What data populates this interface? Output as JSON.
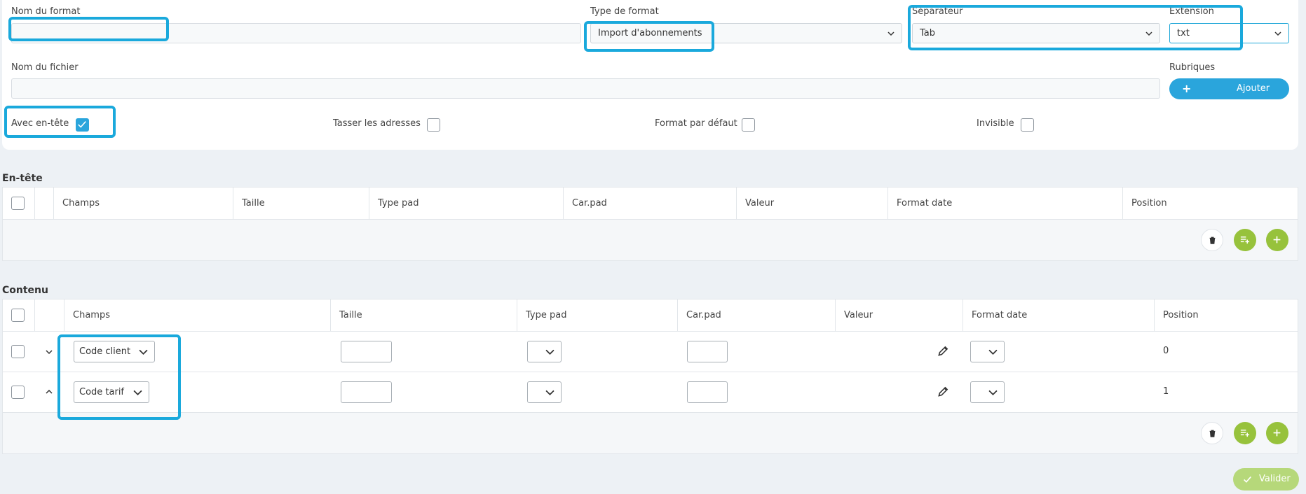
{
  "form": {
    "nom_format_label": "Nom du format",
    "nom_format_value": "",
    "type_format_label": "Type de format",
    "type_format_value": "Import d'abonnements",
    "separateur_label": "Séparateur",
    "separateur_value": "Tab",
    "extension_label": "Extension",
    "extension_value": "txt",
    "nom_fichier_label": "Nom du fichier",
    "nom_fichier_value": "",
    "rubriques_label": "Rubriques",
    "ajouter_label": "Ajouter",
    "avec_entete_label": "Avec en-tête",
    "avec_entete_checked": true,
    "tasser_label": "Tasser les adresses",
    "format_defaut_label": "Format par défaut",
    "invisible_label": "Invisible"
  },
  "entete": {
    "title": "En-tête",
    "columns": [
      "Champs",
      "Taille",
      "Type pad",
      "Car.pad",
      "Valeur",
      "Format date",
      "Position"
    ]
  },
  "contenu": {
    "title": "Contenu",
    "columns": [
      "Champs",
      "Taille",
      "Type pad",
      "Car.pad",
      "Valeur",
      "Format date",
      "Position"
    ],
    "rows": [
      {
        "champ": "Code client",
        "position": "0"
      },
      {
        "champ": "Code tarif",
        "position": "1"
      }
    ]
  },
  "footer": {
    "valider_label": "Valider"
  },
  "colors": {
    "accent": "#2aa5dc",
    "green": "#97c23c",
    "highlight": "#1aa9dc"
  }
}
